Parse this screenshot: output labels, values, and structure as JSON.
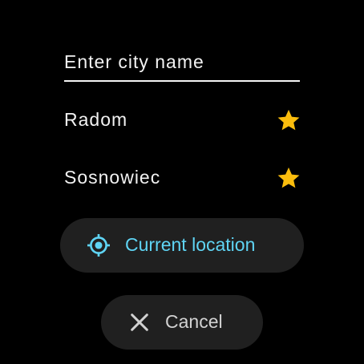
{
  "search": {
    "placeholder": "Enter city name",
    "value": ""
  },
  "favorites": [
    {
      "name": "Radom",
      "icon": "star-icon",
      "starred": true
    },
    {
      "name": "Sosnowiec",
      "icon": "star-icon",
      "starred": true
    }
  ],
  "actions": {
    "location_label": "Current location",
    "location_icon": "gps-fixed-icon",
    "cancel_label": "Cancel",
    "cancel_icon": "close-icon"
  },
  "colors": {
    "background": "#000000",
    "text": "#f2f2f2",
    "star": "#fbbd0d",
    "accent": "#5fd4f4",
    "pill_background": "#202020",
    "cancel_text": "#d2d2d2"
  }
}
